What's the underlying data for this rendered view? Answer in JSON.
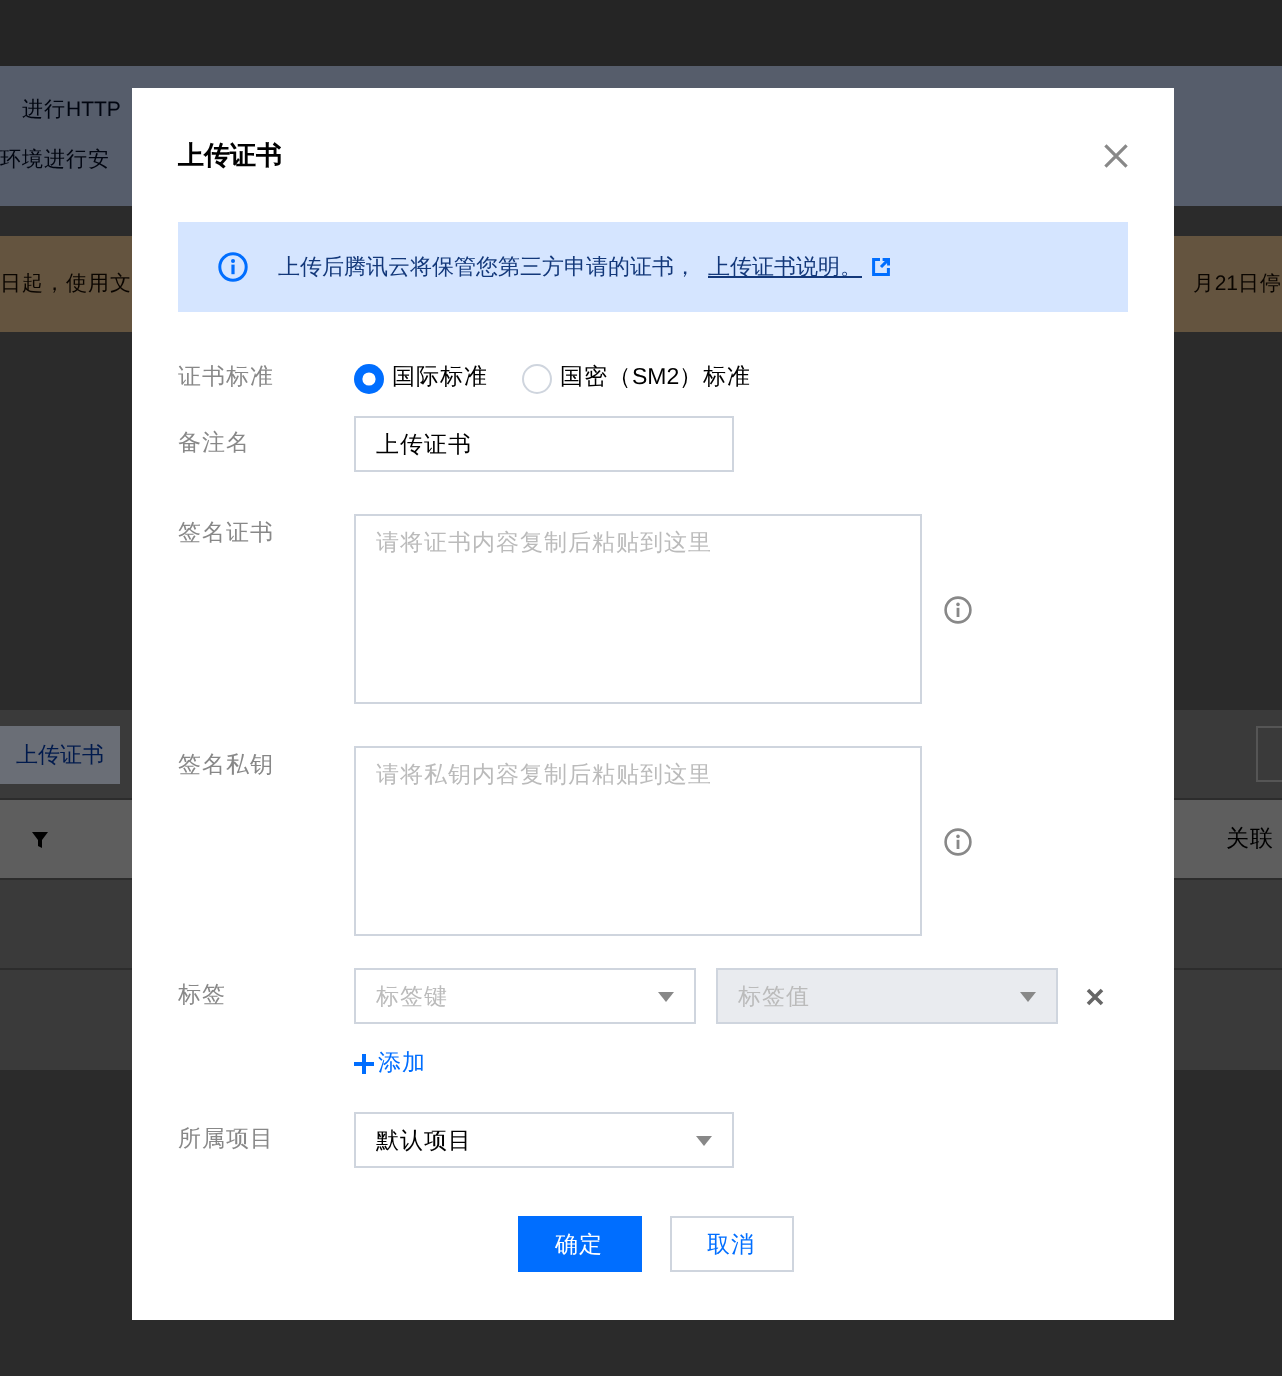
{
  "background_page": {
    "banner_lines": [
      "进行HTTP",
      "环境进行安"
    ],
    "notice": {
      "left_text": "日起，使用文",
      "right_text": "月21日停"
    },
    "toolbar": {
      "upload_button": "上传证书"
    },
    "table_header": {
      "right_column": "关联"
    }
  },
  "dialog": {
    "title": "上传证书",
    "notice": {
      "text": "上传后腾讯云将保管您第三方申请的证书，",
      "link": "上传证书说明。"
    },
    "form": [
      {
        "kind": "radio",
        "label": "证书标准",
        "options": [
          {
            "label": "国际标准",
            "selected": true
          },
          {
            "label": "国密（SM2）标准",
            "selected": false
          }
        ]
      },
      {
        "kind": "input",
        "label": "备注名",
        "value": "上传证书"
      },
      {
        "kind": "textarea",
        "label": "签名证书",
        "placeholder": "请将证书内容复制后粘贴到这里"
      },
      {
        "kind": "textarea",
        "label": "签名私钥",
        "placeholder": "请将私钥内容复制后粘贴到这里"
      },
      {
        "kind": "tags",
        "label": "标签",
        "selects": [
          {
            "placeholder": "标签键",
            "disabled": false
          },
          {
            "placeholder": "标签值",
            "disabled": true
          }
        ],
        "add_link": "添加"
      },
      {
        "kind": "select",
        "label": "所属项目",
        "value": "默认项目"
      }
    ],
    "buttons": [
      {
        "label": "确定",
        "kind": "primary"
      },
      {
        "label": "取消",
        "kind": "secondary"
      }
    ]
  }
}
